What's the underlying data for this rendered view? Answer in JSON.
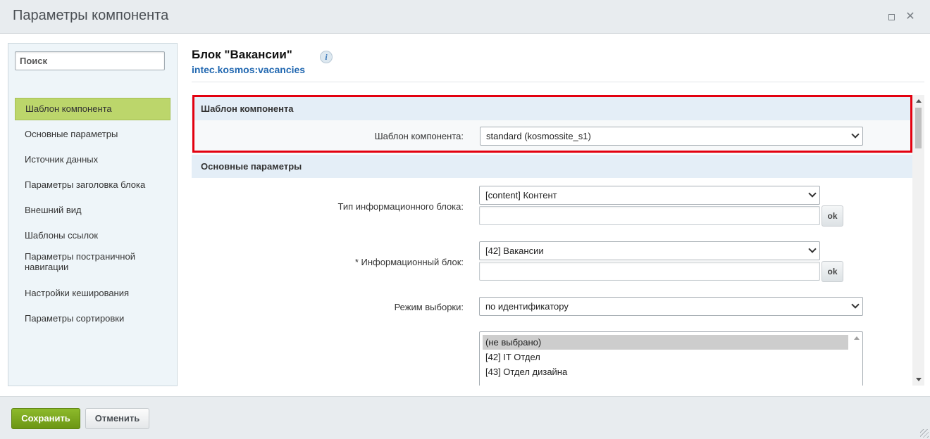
{
  "window": {
    "title": "Параметры компонента",
    "maximize_icon": "maximize-icon",
    "close_icon": "close-icon",
    "close_glyph": "✕"
  },
  "sidebar": {
    "search_placeholder": "Поиск",
    "items": [
      {
        "label": "Шаблон компонента",
        "active": true
      },
      {
        "label": "Основные параметры"
      },
      {
        "label": "Источник данных"
      },
      {
        "label": "Параметры заголовка блока"
      },
      {
        "label": "Внешний вид"
      },
      {
        "label": "Шаблоны ссылок"
      },
      {
        "label": "Параметры постраничной навигации"
      },
      {
        "label": "Настройки кеширования"
      },
      {
        "label": "Параметры сортировки"
      }
    ]
  },
  "header": {
    "title": "Блок \"Вакансии\"",
    "component_code": "intec.kosmos:vacancies",
    "info_glyph": "i"
  },
  "sections": {
    "template": {
      "title": "Шаблон компонента",
      "field_label": "Шаблон компонента:",
      "field_value": "standard (kosmossite_s1)"
    },
    "main": {
      "title": "Основные параметры",
      "iblock_type_label": "Тип информационного блока:",
      "iblock_type_value": "[content] Контент",
      "iblock_label": "* Информационный блок:",
      "iblock_value": "[42] Вакансии",
      "ok_label": "ok",
      "mode_label": "Режим выборки:",
      "mode_value": "по идентификатору",
      "list_options": [
        "(не выбрано)",
        "[42] IT Отдел",
        "[43] Отдел дизайна"
      ]
    }
  },
  "footer": {
    "save_label": "Сохранить",
    "cancel_label": "Отменить"
  },
  "colors": {
    "accent_green": "#7aa81f",
    "highlight_red": "#e3000f",
    "section_bg": "#e4eef7",
    "link_blue": "#2067b0"
  }
}
